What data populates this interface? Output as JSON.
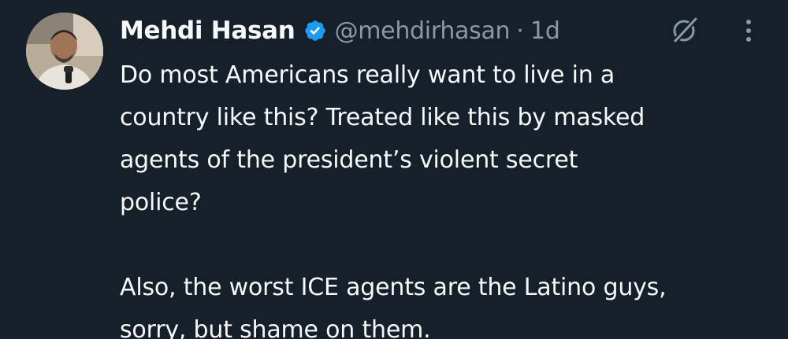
{
  "tweet": {
    "author": {
      "name": "Mehdi Hasan",
      "handle": "@mehdirhasan",
      "separator": "·",
      "time": "1d",
      "verified": true,
      "avatar_icon": "user-avatar"
    },
    "icons": {
      "verified": "verified-badge-icon",
      "grok": "grok-icon",
      "more": "more-options-icon"
    },
    "paragraphs": [
      {
        "lines": [
          "Do most Americans really want to live in a",
          "country like this? Treated like this by masked",
          "agents of the president’s violent secret",
          "police?"
        ]
      },
      {
        "lines": [
          "Also, the worst ICE agents are the Latino guys,",
          "sorry, but shame on them."
        ]
      }
    ]
  },
  "colors": {
    "background": "#15202b",
    "text": "#f7f9f9",
    "secondary": "#8b98a5",
    "verified": "#1d9bf0"
  }
}
